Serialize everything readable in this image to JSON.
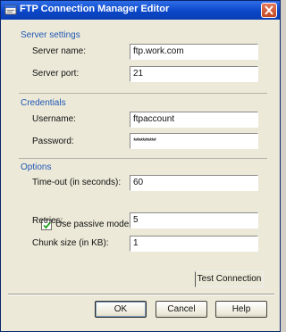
{
  "window": {
    "title": "FTP Connection Manager Editor"
  },
  "sections": {
    "server": {
      "heading": "Server settings",
      "server_name_label": "Server name:",
      "server_name_value": "ftp.work.com",
      "server_port_label": "Server port:",
      "server_port_value": "21"
    },
    "credentials": {
      "heading": "Credentials",
      "username_label": "Username:",
      "username_value": "ftpaccount",
      "password_label": "Password:",
      "password_value": "**********"
    },
    "options": {
      "heading": "Options",
      "timeout_label": "Time-out (in seconds):",
      "timeout_value": "60",
      "passive_mode_label": "Use passive mode",
      "passive_mode_checked": true,
      "retries_label": "Retries:",
      "retries_value": "5",
      "chunk_size_label": "Chunk size (in KB):",
      "chunk_size_value": "1"
    }
  },
  "buttons": {
    "test_connection": "Test Connection",
    "ok": "OK",
    "cancel": "Cancel",
    "help": "Help"
  },
  "icons": {
    "title": "ftp-window-icon",
    "close": "close-icon",
    "check": "check-icon"
  },
  "colors": {
    "titlebar": "#0b47c8",
    "section_heading": "#2157b5",
    "close_button": "#c5461f",
    "checkmark": "#21a121"
  }
}
